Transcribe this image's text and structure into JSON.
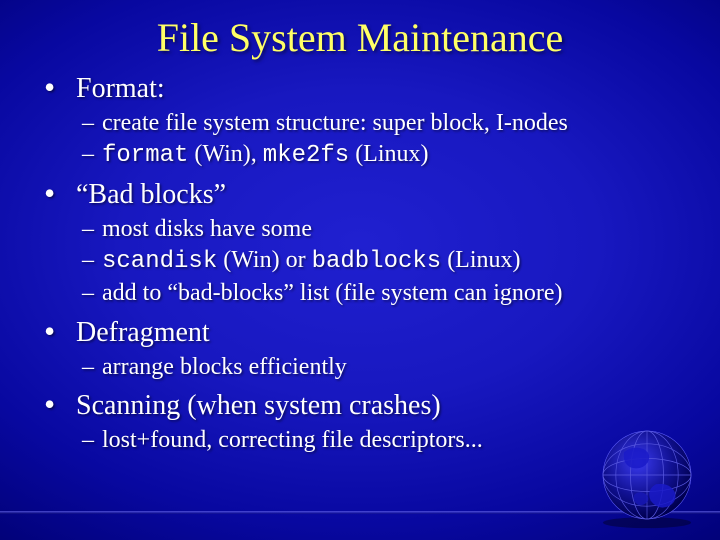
{
  "title": "File System Maintenance",
  "bullets": [
    {
      "label": "Format:",
      "subs": [
        {
          "pre": "create file system structure: super block, I-nodes"
        },
        {
          "code1": "format",
          "mid1": " (Win), ",
          "code2": "mke2fs",
          "tail": " (Linux)"
        }
      ]
    },
    {
      "label": "“Bad blocks”",
      "subs": [
        {
          "pre": "most disks have some"
        },
        {
          "code1": "scandisk",
          "mid1": " (Win) or ",
          "code2": "badblocks",
          "tail": " (Linux)"
        },
        {
          "pre": "add to “bad-blocks” list (file system can ignore)"
        }
      ]
    },
    {
      "label": "Defragment",
      "subs": [
        {
          "pre": "arrange blocks efficiently"
        }
      ]
    },
    {
      "label": "Scanning (when system crashes)",
      "subs": [
        {
          "pre": "lost+found, correcting file descriptors..."
        }
      ]
    }
  ]
}
